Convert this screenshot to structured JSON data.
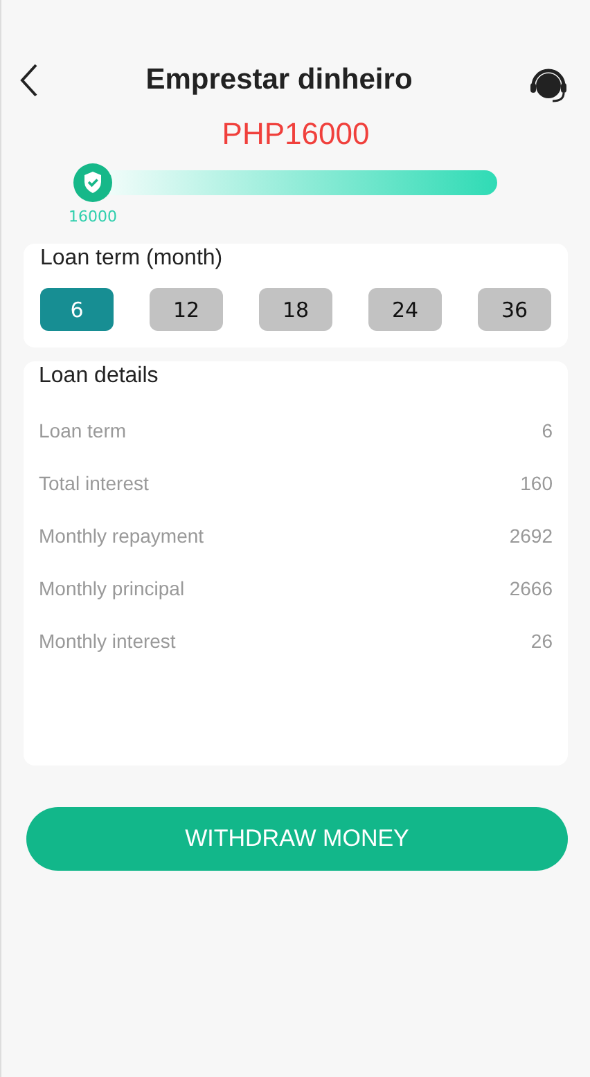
{
  "header": {
    "title": "Emprestar dinheiro"
  },
  "amount": "PHP16000",
  "slider": {
    "level": 0,
    "reading": "16000"
  },
  "loan_term": {
    "title": "Loan term (month)",
    "options": [
      {
        "label": "6",
        "selected": true
      },
      {
        "label": "12",
        "selected": false
      },
      {
        "label": "18",
        "selected": false
      },
      {
        "label": "24",
        "selected": false
      },
      {
        "label": "36",
        "selected": false
      }
    ]
  },
  "loan_details": {
    "title": "Loan details",
    "rows": [
      {
        "label": "Loan term",
        "value": "6"
      },
      {
        "label": "Total interest",
        "value": "160"
      },
      {
        "label": "Monthly repayment",
        "value": "2692"
      },
      {
        "label": "Monthly principal",
        "value": "2666"
      },
      {
        "label": "Monthly interest",
        "value": "26"
      }
    ]
  },
  "button": "WITHDRAW MONEY"
}
